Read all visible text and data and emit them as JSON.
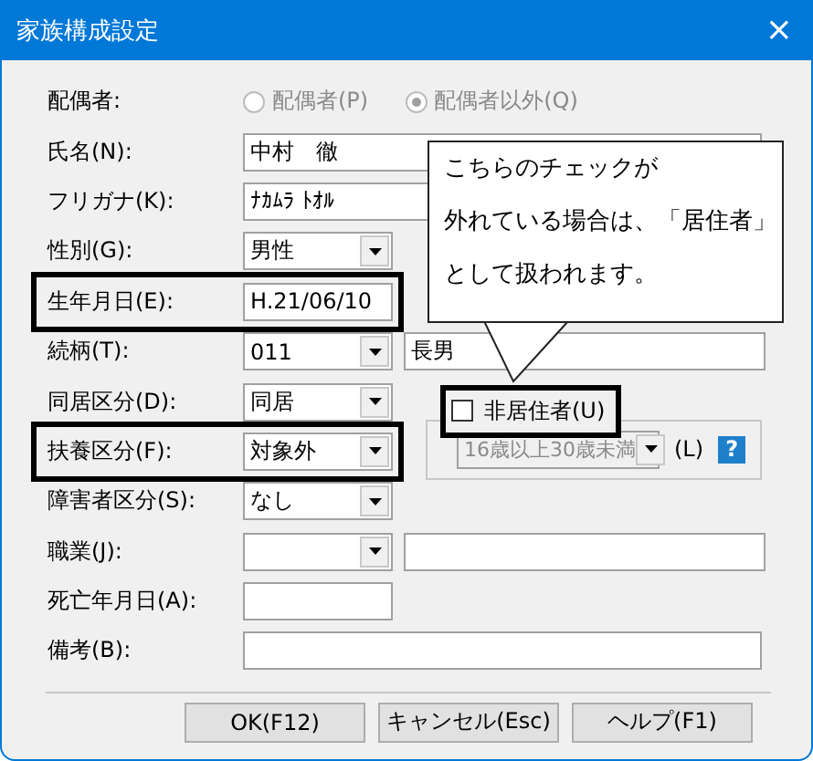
{
  "window": {
    "title": "家族構成設定",
    "close": "×"
  },
  "rows": [
    {
      "kind": "radio",
      "label": "配偶者:",
      "disabled": true,
      "options": [
        {
          "label": "配偶者(P)",
          "selected": false
        },
        {
          "label": "配偶者以外(Q)",
          "selected": true
        }
      ]
    },
    {
      "kind": "wide_text",
      "label": "氏名(N):",
      "value": "中村　徹"
    },
    {
      "kind": "wide_text",
      "label": "フリガナ(K):",
      "value": "ﾅｶﾑﾗ ﾄｵﾙ"
    },
    {
      "kind": "select",
      "label": "性別(G):",
      "value": "男性"
    },
    {
      "kind": "text",
      "label": "生年月日(E):",
      "value": "H.21/06/10",
      "highlighted": true
    },
    {
      "kind": "select_text",
      "label": "続柄(T):",
      "value": "011",
      "extra": "長男"
    },
    {
      "kind": "select",
      "label": "同居区分(D):",
      "value": "同居"
    },
    {
      "kind": "select",
      "label": "扶養区分(F):",
      "value": "対象外",
      "highlighted": true,
      "non_resident": {
        "label": "非居住者(U)",
        "checked": false,
        "highlighted": true,
        "select": {
          "value": "16歳以上30歳未満",
          "disabled": true
        },
        "shortcut": "(L)",
        "help": "?"
      }
    },
    {
      "kind": "select",
      "label": "障害者区分(S):",
      "value": "なし"
    },
    {
      "kind": "select_text",
      "label": "職業(J):"
    },
    {
      "kind": "text",
      "label": "死亡年月日(A):"
    },
    {
      "kind": "wide_text",
      "label": "備考(B):"
    }
  ],
  "callout": {
    "lines": [
      "こちらのチェックが",
      "外れている場合は、「居住者」",
      "として扱われます。"
    ]
  },
  "buttons": [
    "OK(F12)",
    "キャンセル(Esc)",
    "ヘルプ(F1)"
  ]
}
